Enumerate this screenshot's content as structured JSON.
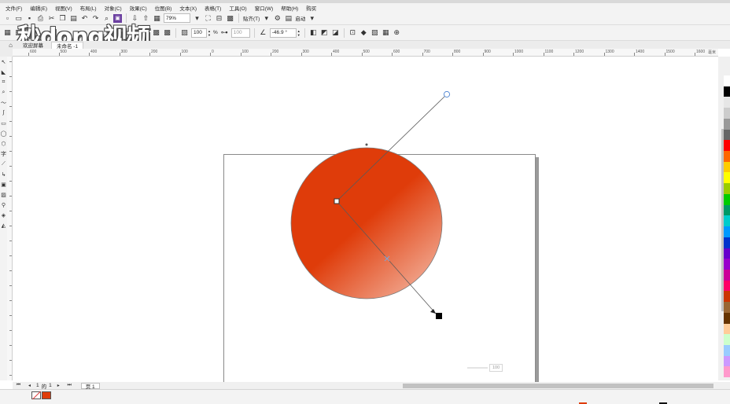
{
  "menu": [
    "文件(F)",
    "编辑(E)",
    "视图(V)",
    "布局(L)",
    "对象(C)",
    "效果(C)",
    "位图(B)",
    "文本(X)",
    "表格(T)",
    "工具(O)",
    "窗口(W)",
    "帮助(H)",
    "购买"
  ],
  "toolbar": {
    "zoom": "79%",
    "snap_label": "贴齐(T)",
    "launch_label": "启动"
  },
  "property_bar": {
    "transparency": "100",
    "percent_sign": "%",
    "midpoint": "100",
    "angle": "-46.9 °"
  },
  "watermark": "秒dong视频",
  "document_tabs": [
    "欢迎屏幕",
    "未命名 -1"
  ],
  "ruler_labels": [
    "600",
    "500",
    "400",
    "300",
    "200",
    "100",
    "0",
    "100",
    "200",
    "300",
    "400",
    "500",
    "600",
    "700",
    "800",
    "900",
    "1000",
    "1100",
    "1200",
    "1300",
    "1400",
    "1500",
    "1600",
    "毫米"
  ],
  "canvas": {
    "gradient_start": "#df3c0a",
    "gradient_end": "#f8cfc1",
    "opacity_value": "100"
  },
  "page_nav": {
    "current": "1",
    "of_label": "的",
    "total": "1",
    "page_tab": "页 1"
  },
  "palette": [
    "#ffffff",
    "#000000",
    "#e6e6e6",
    "#cccccc",
    "#999999",
    "#666666",
    "#ff0000",
    "#ff6600",
    "#ffcc00",
    "#ffff00",
    "#99cc00",
    "#00cc00",
    "#009966",
    "#00cccc",
    "#0099ff",
    "#0033cc",
    "#6600cc",
    "#9900cc",
    "#cc0099",
    "#ff0066",
    "#cc3300",
    "#996633",
    "#663300",
    "#ffcc99",
    "#ccffcc",
    "#99ccff",
    "#cc99ff",
    "#ff99cc"
  ]
}
